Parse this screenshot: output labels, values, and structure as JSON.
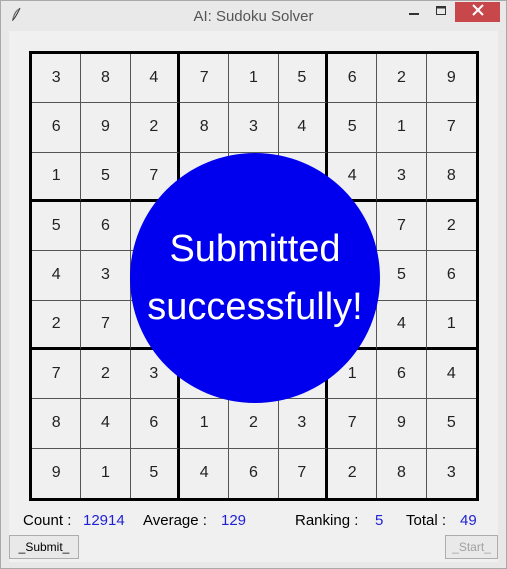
{
  "window": {
    "title": "AI: Sudoku Solver",
    "close_color": "#c7474a"
  },
  "icons": {
    "app": "feather-icon",
    "minimize": "minimize-icon",
    "maximize": "maximize-icon",
    "close": "close-icon"
  },
  "board": [
    [
      "3",
      "8",
      "4",
      "7",
      "1",
      "5",
      "6",
      "2",
      "9"
    ],
    [
      "6",
      "9",
      "2",
      "8",
      "3",
      "4",
      "5",
      "1",
      "7"
    ],
    [
      "1",
      "5",
      "7",
      "",
      "",
      "",
      "4",
      "3",
      "8"
    ],
    [
      "5",
      "6",
      "",
      "",
      "",
      "",
      "",
      "7",
      "2"
    ],
    [
      "4",
      "3",
      "",
      "",
      "",
      "",
      "",
      "5",
      "6"
    ],
    [
      "2",
      "7",
      "",
      "",
      "",
      "",
      "",
      "4",
      "1"
    ],
    [
      "7",
      "2",
      "3",
      "",
      "",
      "",
      "1",
      "6",
      "4"
    ],
    [
      "8",
      "4",
      "6",
      "1",
      "2",
      "3",
      "7",
      "9",
      "5"
    ],
    [
      "9",
      "1",
      "5",
      "4",
      "6",
      "7",
      "2",
      "8",
      "3"
    ]
  ],
  "overlay": {
    "line1": "Submitted",
    "line2": "successfully!",
    "color": "#0000ee"
  },
  "stats": {
    "count_label": "Count :",
    "count_value": "12914",
    "average_label": "Average :",
    "average_value": "129",
    "ranking_label": "Ranking :",
    "ranking_value": "5",
    "total_label": "Total :",
    "total_value": "49",
    "value_color": "#1f1fd6"
  },
  "buttons": {
    "submit_label": "_Submit_",
    "start_label": "_Start_"
  }
}
